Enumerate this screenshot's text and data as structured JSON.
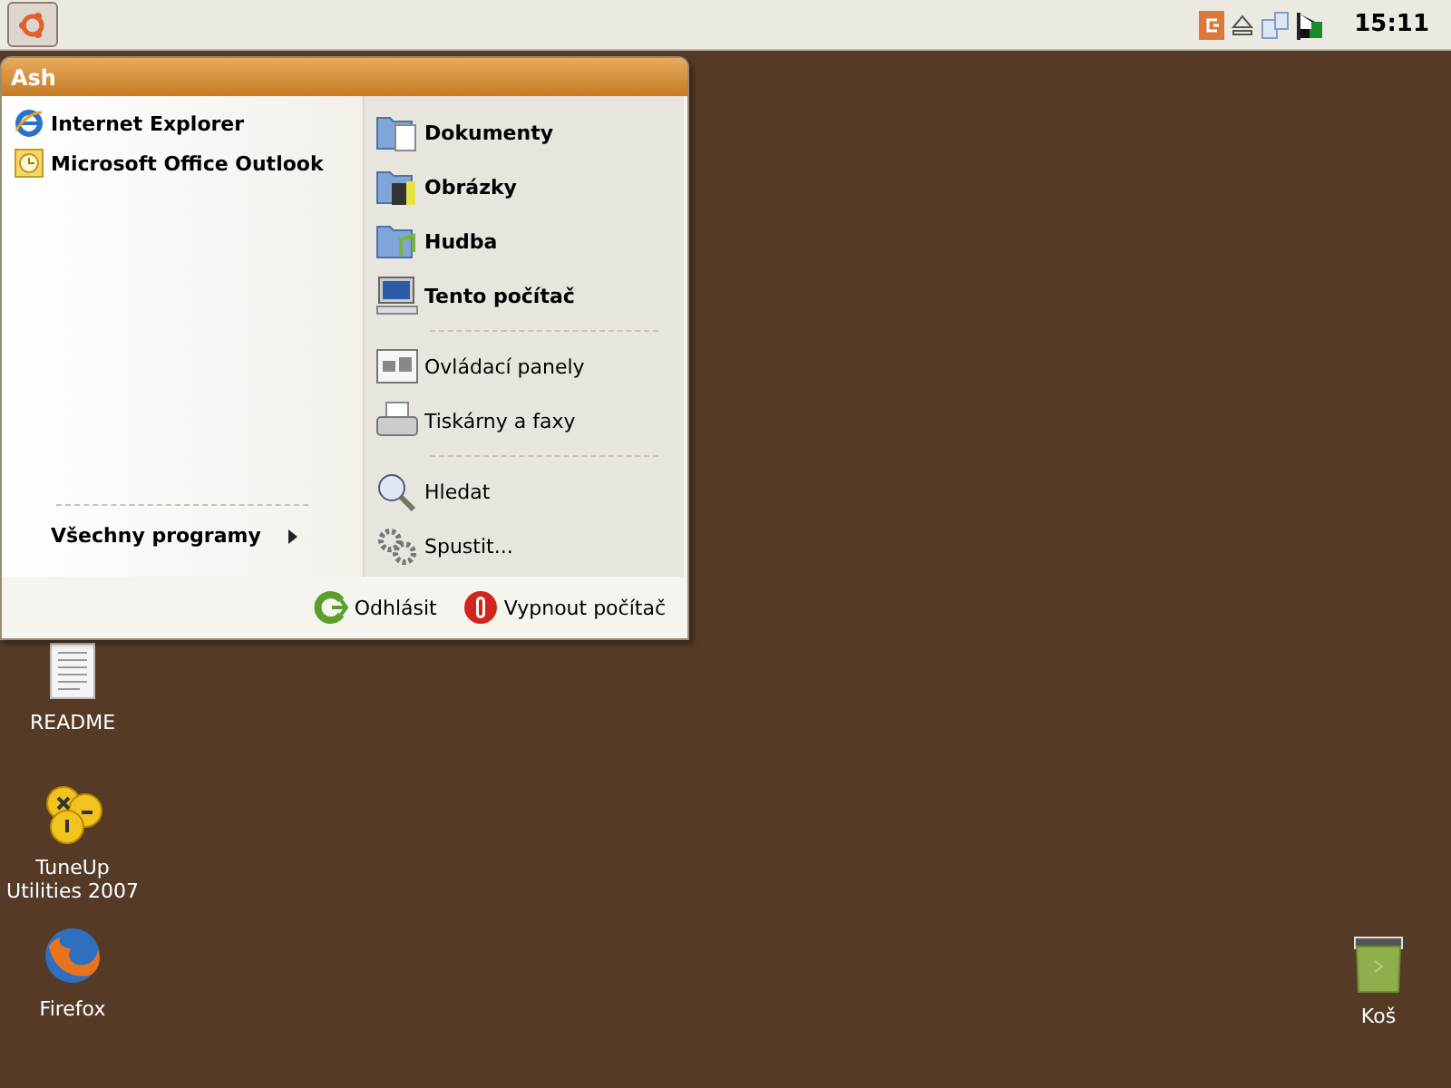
{
  "panel": {
    "clock": "15:11"
  },
  "start_menu": {
    "user": "Ash",
    "pinned": [
      {
        "label": "Internet Explorer",
        "kind": "browser"
      },
      {
        "label": "Microsoft Office Outlook",
        "kind": "mail"
      }
    ],
    "all_programs": "Všechny programy",
    "places": [
      [
        {
          "label": "Dokumenty",
          "kind": "documents",
          "bold": true
        },
        {
          "label": "Obrázky",
          "kind": "pictures",
          "bold": true
        },
        {
          "label": "Hudba",
          "kind": "music",
          "bold": true
        },
        {
          "label": "Tento počítač",
          "kind": "computer",
          "bold": true
        }
      ],
      [
        {
          "label": "Ovládací panely",
          "kind": "control",
          "bold": false
        },
        {
          "label": "Tiskárny a faxy",
          "kind": "printer",
          "bold": false
        }
      ],
      [
        {
          "label": "Hledat",
          "kind": "search",
          "bold": false
        },
        {
          "label": "Spustit...",
          "kind": "run",
          "bold": false
        }
      ]
    ],
    "log_off": "Odhlásit",
    "shut_down": "Vypnout počítač"
  },
  "desktop_icons": [
    {
      "label": "README",
      "kind": "document"
    },
    {
      "label": "TuneUp Utilities 2007",
      "kind": "tuneup"
    },
    {
      "label": "Firefox",
      "kind": "firefox"
    }
  ],
  "trash": {
    "label": "Koš"
  }
}
